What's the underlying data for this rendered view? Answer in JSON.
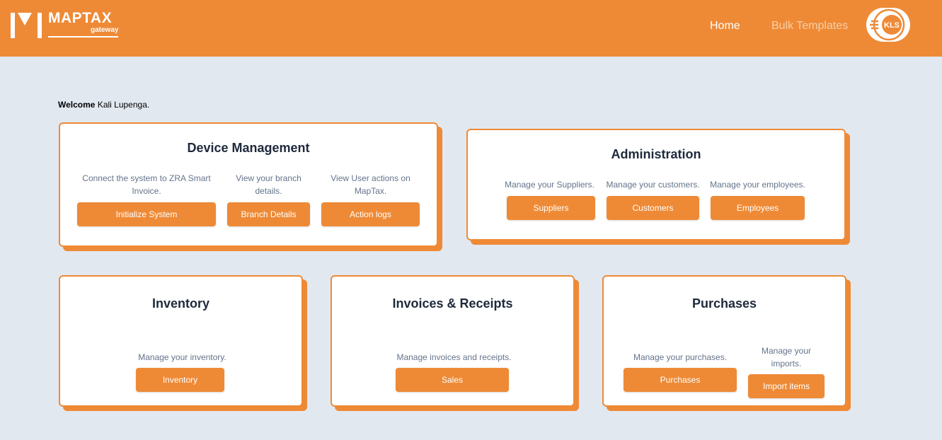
{
  "header": {
    "logo_title": "MAPTAX",
    "logo_subtitle": "gateway",
    "nav": {
      "home": "Home",
      "bulk_templates": "Bulk Templates"
    },
    "avatar_text": "KLS",
    "bg_color": "#ee8a36"
  },
  "welcome": {
    "label": "Welcome",
    "name": "Kali Lupenga."
  },
  "cards": {
    "device_management": {
      "title": "Device Management",
      "items": [
        {
          "desc": "Connect the system to ZRA Smart Invoice.",
          "button": "Initialize System"
        },
        {
          "desc": "View your branch details.",
          "button": "Branch Details"
        },
        {
          "desc": "View User actions on MapTax.",
          "button": "Action logs"
        }
      ]
    },
    "administration": {
      "title": "Administration",
      "items": [
        {
          "desc": "Manage your Suppliers.",
          "button": "Suppliers"
        },
        {
          "desc": "Manage your customers.",
          "button": "Customers"
        },
        {
          "desc": "Manage your employees.",
          "button": "Employees"
        }
      ]
    },
    "inventory": {
      "title": "Inventory",
      "items": [
        {
          "desc": "Manage your inventory.",
          "button": "Inventory"
        }
      ]
    },
    "invoices": {
      "title": "Invoices & Receipts",
      "items": [
        {
          "desc": "Manage invoices and receipts.",
          "button": "Sales"
        }
      ]
    },
    "purchases": {
      "title": "Purchases",
      "items": [
        {
          "desc": "Manage your purchases.",
          "button": "Purchases"
        },
        {
          "desc": "Manage your imports.",
          "button": "Import items"
        }
      ]
    }
  },
  "colors": {
    "accent": "#ee8a36",
    "background": "#e2e8f0",
    "text_muted": "#64748b",
    "heading": "#1e293b"
  }
}
